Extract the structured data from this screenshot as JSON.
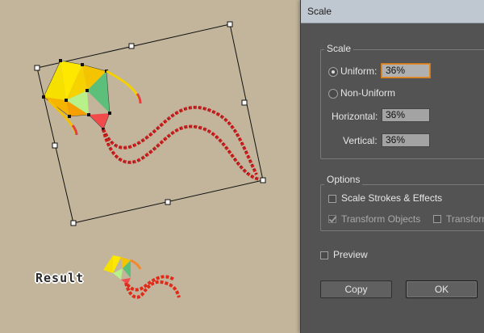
{
  "canvas": {
    "result_label": "Result"
  },
  "dialog": {
    "title": "Scale",
    "scale_group": {
      "legend": "Scale",
      "uniform_label": "Uniform:",
      "uniform_value": "36%",
      "uniform_selected": true,
      "non_uniform_label": "Non-Uniform",
      "horizontal_label": "Horizontal:",
      "horizontal_value": "36%",
      "vertical_label": "Vertical:",
      "vertical_value": "36%"
    },
    "options_group": {
      "legend": "Options",
      "scale_strokes_label": "Scale Strokes & Effects",
      "transform_objects_label": "Transform Objects",
      "transform_patterns_label": "Transform"
    },
    "preview_label": "Preview",
    "copy_label": "Copy",
    "ok_label": "OK"
  },
  "colors": {
    "canvas_bg": "#c2b59b",
    "dialog_bg": "#535353",
    "kite_yellow": "#f5e000",
    "kite_orange": "#f5b400",
    "kite_green": "#5cbf7a",
    "kite_light_green": "#b8f08a",
    "kite_red": "#f24a4a",
    "tail_red": "#cc1f1f",
    "focus_orange": "#e48a27"
  }
}
